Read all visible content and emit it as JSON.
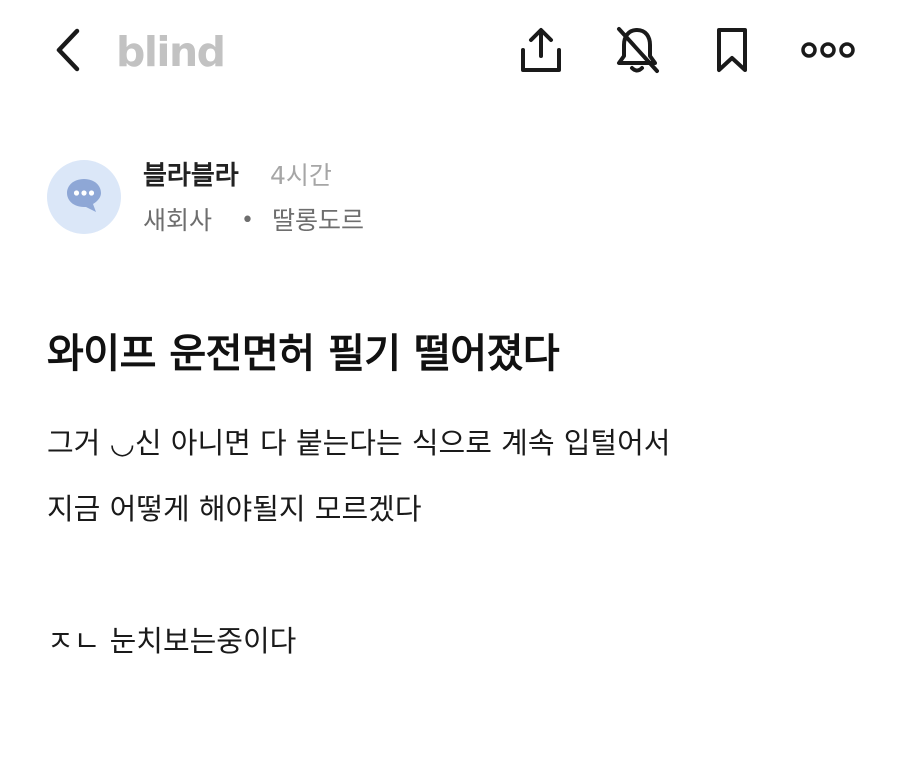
{
  "header": {
    "logo": "blind",
    "icons": [
      "back-icon",
      "share-icon",
      "bell-off-icon",
      "bookmark-icon",
      "more-icon"
    ]
  },
  "author": {
    "avatar_icon": "chat-bubble-icon",
    "name": "블라블라",
    "time": "4시간",
    "company": "새회사",
    "separator": "•",
    "nickname": "딸롱도르"
  },
  "post": {
    "title": "와이프 운전면허 필기 떨어졌다",
    "lines": [
      "그거 ◡신 아니면 다 붙는다는 식으로 계속 입털어서",
      "지금 어떻게 해야될지 모르겠다",
      "",
      "ㅈㄴ 눈치보는중이다"
    ]
  },
  "colors": {
    "logo": "#c2c2c2",
    "avatar_bg": "#dbe7f8",
    "avatar_icon": "#8ea7d6",
    "muted_text": "#a6a6a6",
    "secondary_text": "#6e6e6e"
  }
}
